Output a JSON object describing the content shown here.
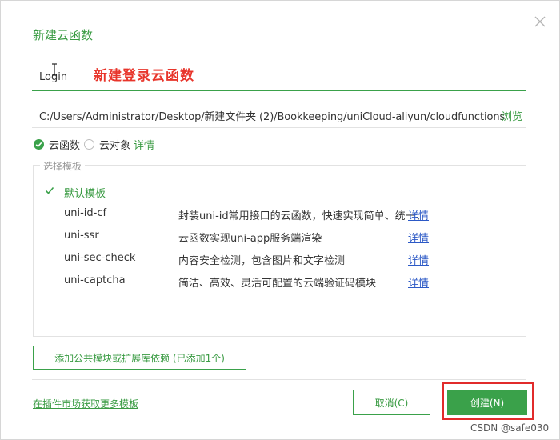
{
  "dialog": {
    "title": "新建云函数",
    "close_icon": "close-icon"
  },
  "name_field": {
    "value": "Login"
  },
  "annotation": {
    "text": "新建登录云函数",
    "color": "#e8352b"
  },
  "path": {
    "value": "C:/Users/Administrator/Desktop/新建文件夹 (2)/Bookkeeping/uniCloud-aliyun/cloudfunctions",
    "browse_label": "浏览"
  },
  "type_options": [
    {
      "label": "云函数",
      "checked": true
    },
    {
      "label": "云对象",
      "checked": false
    }
  ],
  "type_detail_link": "详情",
  "templates": {
    "legend": "选择模板",
    "items": [
      {
        "name": "默认模板",
        "description": "",
        "link": "",
        "selected": true
      },
      {
        "name": "uni-id-cf",
        "description": "封装uni-id常用接口的云函数，快速实现简单、统一、",
        "link": "详情",
        "selected": false
      },
      {
        "name": "uni-ssr",
        "description": "云函数实现uni-app服务端渲染",
        "link": "详情",
        "selected": false
      },
      {
        "name": "uni-sec-check",
        "description": "内容安全检测，包含图片和文字检测",
        "link": "详情",
        "selected": false
      },
      {
        "name": "uni-captcha",
        "description": "简洁、高效、灵活可配置的云端验证码模块",
        "link": "详情",
        "selected": false
      }
    ]
  },
  "add_module_button": "添加公共模块或扩展库依赖 (已添加1个)",
  "market_link": "在插件市场获取更多模板",
  "cancel_button": "取消(C)",
  "create_button": "创建(N)",
  "watermark": "CSDN @safe030",
  "colors": {
    "accent": "#3aa14a",
    "accent_text": "#3a9b43",
    "link_blue": "#2c59c6",
    "highlight_red": "#e12b2b"
  }
}
